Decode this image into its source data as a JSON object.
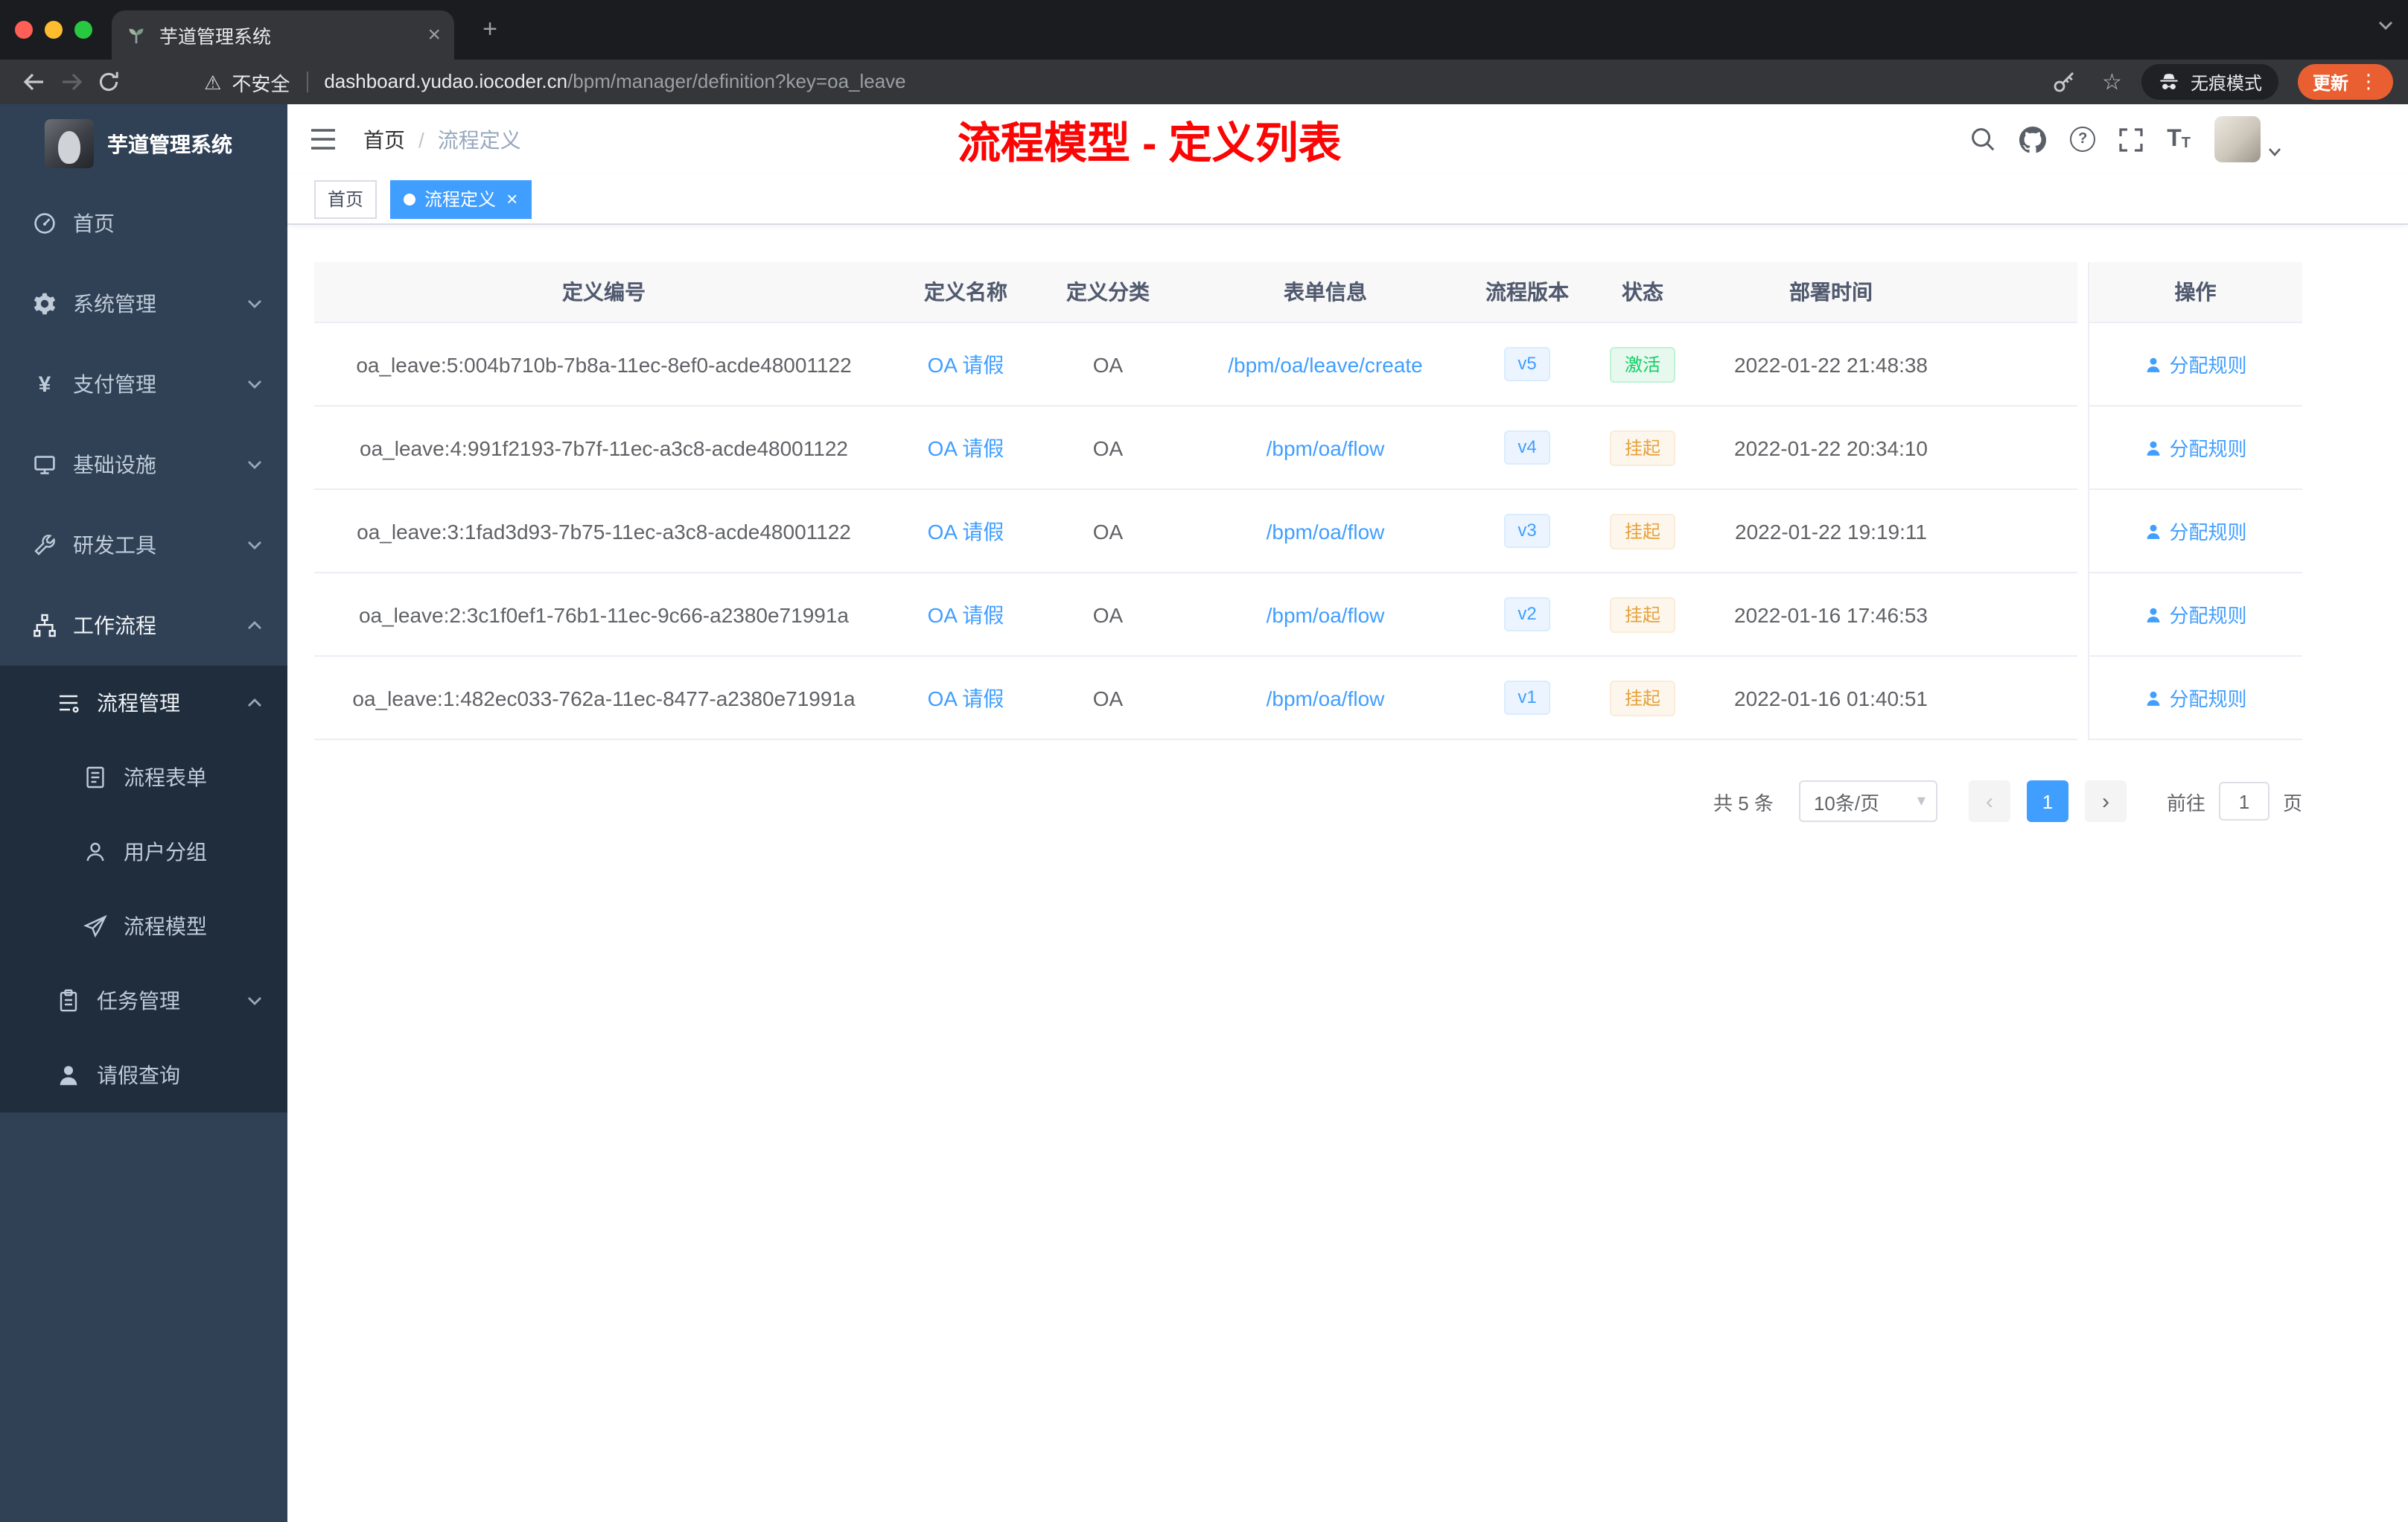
{
  "browser": {
    "tab_title": "芋道管理系统",
    "security_label": "不安全",
    "url_host": "dashboard.yudao.iocoder.cn",
    "url_path": "/bpm/manager/definition?key=oa_leave",
    "incognito_label": "无痕模式",
    "update_label": "更新"
  },
  "icons": {
    "close": "×",
    "plus": "+",
    "warning": "⚠",
    "star": "☆",
    "more": "⋮",
    "yen": "¥",
    "question": "?",
    "font_large": "T",
    "font_small": "T",
    "prev": "‹",
    "next": "›",
    "caret": "▾"
  },
  "sidebar": {
    "app_title": "芋道管理系统",
    "items": [
      {
        "label": "首页",
        "icon": "dashboard-icon",
        "level": 1
      },
      {
        "label": "系统管理",
        "icon": "gear-icon",
        "level": 1,
        "chevron": "down"
      },
      {
        "label": "支付管理",
        "icon": "yen-icon",
        "level": 1,
        "chevron": "down"
      },
      {
        "label": "基础设施",
        "icon": "monitor-icon",
        "level": 1,
        "chevron": "down"
      },
      {
        "label": "研发工具",
        "icon": "wrench-icon",
        "level": 1,
        "chevron": "down"
      },
      {
        "label": "工作流程",
        "icon": "tree-icon",
        "level": 1,
        "chevron": "up",
        "expanded": true
      },
      {
        "label": "流程管理",
        "icon": "list-icon",
        "level": 2,
        "chevron": "up",
        "expanded": true
      },
      {
        "label": "流程表单",
        "icon": "form-icon",
        "level": 3
      },
      {
        "label": "用户分组",
        "icon": "users-icon",
        "level": 3
      },
      {
        "label": "流程模型",
        "icon": "send-icon",
        "level": 3
      },
      {
        "label": "任务管理",
        "icon": "clipboard-icon",
        "level": 2,
        "chevron": "down"
      },
      {
        "label": "请假查询",
        "icon": "person-icon",
        "level": 2
      }
    ]
  },
  "header": {
    "breadcrumb_home": "首页",
    "breadcrumb_sep": "/",
    "breadcrumb_current": "流程定义",
    "annotation": "流程模型 - 定义列表"
  },
  "tags": {
    "home": "首页",
    "active": "流程定义"
  },
  "table": {
    "columns": [
      "定义编号",
      "定义名称",
      "定义分类",
      "表单信息",
      "流程版本",
      "状态",
      "部署时间",
      "操作"
    ],
    "action_label": "分配规则",
    "rows": [
      {
        "id": "oa_leave:5:004b710b-7b8a-11ec-8ef0-acde48001122",
        "name": "OA 请假",
        "category": "OA",
        "form": "/bpm/oa/leave/create",
        "version": "v5",
        "status": "激活",
        "status_type": "success",
        "time": "2022-01-22 21:48:38"
      },
      {
        "id": "oa_leave:4:991f2193-7b7f-11ec-a3c8-acde48001122",
        "name": "OA 请假",
        "category": "OA",
        "form": "/bpm/oa/flow",
        "version": "v4",
        "status": "挂起",
        "status_type": "warning",
        "time": "2022-01-22 20:34:10"
      },
      {
        "id": "oa_leave:3:1fad3d93-7b75-11ec-a3c8-acde48001122",
        "name": "OA 请假",
        "category": "OA",
        "form": "/bpm/oa/flow",
        "version": "v3",
        "status": "挂起",
        "status_type": "warning",
        "time": "2022-01-22 19:19:11"
      },
      {
        "id": "oa_leave:2:3c1f0ef1-76b1-11ec-9c66-a2380e71991a",
        "name": "OA 请假",
        "category": "OA",
        "form": "/bpm/oa/flow",
        "version": "v2",
        "status": "挂起",
        "status_type": "warning",
        "time": "2022-01-16 17:46:53"
      },
      {
        "id": "oa_leave:1:482ec033-762a-11ec-8477-a2380e71991a",
        "name": "OA 请假",
        "category": "OA",
        "form": "/bpm/oa/flow",
        "version": "v1",
        "status": "挂起",
        "status_type": "warning",
        "time": "2022-01-16 01:40:51"
      }
    ]
  },
  "pagination": {
    "total": "共 5 条",
    "page_size": "10条/页",
    "current_page": "1",
    "goto_label": "前往",
    "goto_value": "1",
    "page_label": "页"
  },
  "colors": {
    "accent": "#409eff",
    "annotation_red": "#fb0505",
    "status_active_green": "#13ce66",
    "status_suspended_orange": "#e6a23c",
    "sidebar_bg": "#304156",
    "submenu_bg": "#1f2d3d",
    "update_chip": "#e95f32"
  }
}
